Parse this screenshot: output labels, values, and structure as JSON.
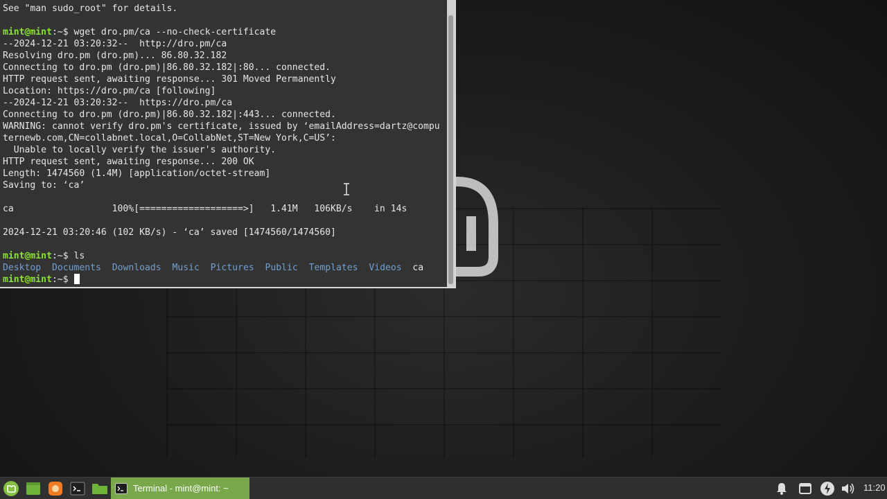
{
  "terminal": {
    "lines": [
      {
        "type": "text",
        "text": "See \"man sudo_root\" for details."
      },
      {
        "type": "text",
        "text": ""
      },
      {
        "type": "prompt",
        "prompt": "mint@mint",
        "path": ":~$ ",
        "command": "wget dro.pm/ca --no-check-certificate"
      },
      {
        "type": "text",
        "text": "--2024-12-21 03:20:32--  http://dro.pm/ca"
      },
      {
        "type": "text",
        "text": "Resolving dro.pm (dro.pm)... 86.80.32.182"
      },
      {
        "type": "text",
        "text": "Connecting to dro.pm (dro.pm)|86.80.32.182|:80... connected."
      },
      {
        "type": "text",
        "text": "HTTP request sent, awaiting response... 301 Moved Permanently"
      },
      {
        "type": "text",
        "text": "Location: https://dro.pm/ca [following]"
      },
      {
        "type": "text",
        "text": "--2024-12-21 03:20:32--  https://dro.pm/ca"
      },
      {
        "type": "text",
        "text": "Connecting to dro.pm (dro.pm)|86.80.32.182|:443... connected."
      },
      {
        "type": "text",
        "text": "WARNING: cannot verify dro.pm's certificate, issued by ‘emailAddress=dartz@compu"
      },
      {
        "type": "text",
        "text": "ternewb.com,CN=collabnet.local,O=CollabNet,ST=New York,C=US’:"
      },
      {
        "type": "text",
        "text": "  Unable to locally verify the issuer's authority."
      },
      {
        "type": "text",
        "text": "HTTP request sent, awaiting response... 200 OK"
      },
      {
        "type": "text",
        "text": "Length: 1474560 (1.4M) [application/octet-stream]"
      },
      {
        "type": "text",
        "text": "Saving to: ‘ca’"
      },
      {
        "type": "text",
        "text": ""
      },
      {
        "type": "text",
        "text": "ca                  100%[===================>]   1.41M   106KB/s    in 14s"
      },
      {
        "type": "text",
        "text": ""
      },
      {
        "type": "text",
        "text": "2024-12-21 03:20:46 (102 KB/s) - ‘ca’ saved [1474560/1474560]"
      },
      {
        "type": "text",
        "text": ""
      },
      {
        "type": "prompt",
        "prompt": "mint@mint",
        "path": ":~$ ",
        "command": "ls"
      },
      {
        "type": "ls",
        "dirs": [
          "Desktop",
          "Documents",
          "Downloads",
          "Music",
          "Pictures",
          "Public",
          "Templates",
          "Videos"
        ],
        "files": [
          "ca"
        ]
      },
      {
        "type": "prompt-cursor",
        "prompt": "mint@mint",
        "path": ":~$ ",
        "command": ""
      }
    ]
  },
  "panel": {
    "launchers": [
      {
        "name": "mint-menu-icon",
        "color": "#86be43"
      },
      {
        "name": "show-desktop-icon",
        "color": "#6fb33b"
      },
      {
        "name": "firefox-icon",
        "color": "#f47b26"
      },
      {
        "name": "terminal-launcher-icon",
        "color": "#3a3a3a"
      },
      {
        "name": "files-icon",
        "color": "#6fb33b"
      }
    ],
    "task": {
      "label": "Terminal - mint@mint: ~"
    },
    "clock": "11:20"
  },
  "colors": {
    "prompt": "#8ae234",
    "directory": "#729fcf",
    "terminal_bg": "#333333",
    "task_active": "#79a84c"
  }
}
